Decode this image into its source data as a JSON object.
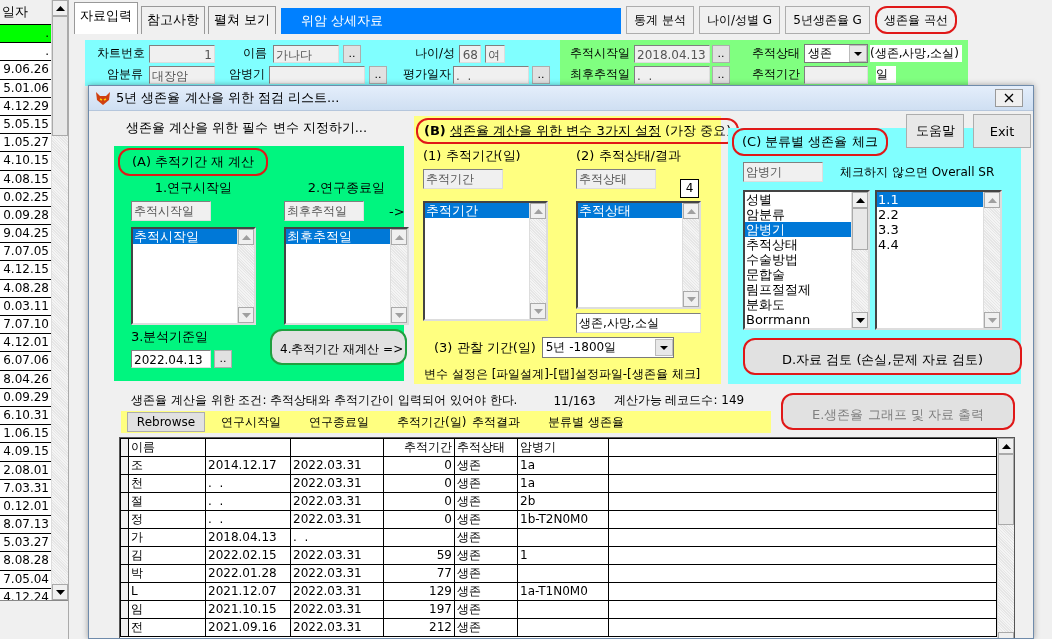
{
  "app": {
    "record_list": {
      "header": "일자",
      "rows": [
        {
          "value": ".",
          "selected": true
        },
        {
          "value": ".",
          "selected": false
        },
        {
          "value": "9.06.26",
          "selected": false
        },
        {
          "value": "5.01.06",
          "selected": false
        },
        {
          "value": "4.12.29",
          "selected": false
        },
        {
          "value": "5.05.15",
          "selected": false
        },
        {
          "value": "1.05.27",
          "selected": false
        },
        {
          "value": "4.10.15",
          "selected": false
        },
        {
          "value": "4.08.15",
          "selected": false
        },
        {
          "value": "0.02.25",
          "selected": false
        },
        {
          "value": "0.09.28",
          "selected": false
        },
        {
          "value": "9.04.25",
          "selected": false
        },
        {
          "value": "7.07.05",
          "selected": false
        },
        {
          "value": "4.12.15",
          "selected": false
        },
        {
          "value": "4.08.28",
          "selected": false
        },
        {
          "value": "0.03.11",
          "selected": false
        },
        {
          "value": "7.07.10",
          "selected": false
        },
        {
          "value": "4.12.01",
          "selected": false
        },
        {
          "value": "6.07.06",
          "selected": false
        },
        {
          "value": "8.04.26",
          "selected": false
        },
        {
          "value": "0.09.29",
          "selected": false
        },
        {
          "value": "6.10.31",
          "selected": false
        },
        {
          "value": "1.06.15",
          "selected": false
        },
        {
          "value": "4.09.15",
          "selected": false
        },
        {
          "value": "2.08.01",
          "selected": false
        },
        {
          "value": "7.03.31",
          "selected": false
        },
        {
          "value": "0.12.01",
          "selected": false
        },
        {
          "value": "8.07.13",
          "selected": false
        },
        {
          "value": "5.03.27",
          "selected": false
        },
        {
          "value": "8.08.28",
          "selected": false
        },
        {
          "value": "7.05.04",
          "selected": false
        },
        {
          "value": "4.12.24",
          "selected": false
        }
      ]
    },
    "tabs": [
      {
        "label": "자료입력",
        "selected": true
      },
      {
        "label": "참고사항",
        "selected": false
      },
      {
        "label": "펼쳐 보기",
        "selected": false
      }
    ],
    "banner": "위암 상세자료",
    "toolbar": [
      {
        "label": "통계 분석",
        "circled": false
      },
      {
        "label": "나이/성별 G",
        "circled": false
      },
      {
        "label": "5년생존율 G",
        "circled": false
      },
      {
        "label": "생존율 곡선",
        "circled": true,
        "color": "#e01818"
      }
    ],
    "patient_panel": {
      "rows": [
        [
          {
            "kind": "label",
            "text": "차트번호"
          },
          {
            "kind": "number_field",
            "value": "1"
          },
          {
            "kind": "label",
            "text": "이름"
          },
          {
            "kind": "field",
            "value": "가나다"
          },
          {
            "kind": "button",
            "text": ".."
          },
          {
            "kind": "label",
            "text": "나이/성"
          },
          {
            "kind": "number_field",
            "value": "68"
          },
          {
            "kind": "field",
            "value": "여"
          }
        ],
        [
          {
            "kind": "label",
            "text": "암분류"
          },
          {
            "kind": "field",
            "value": "대장암"
          },
          {
            "kind": "label",
            "text": "암병기"
          },
          {
            "kind": "field"
          },
          {
            "kind": "button",
            "text": ".."
          },
          {
            "kind": "label",
            "text": "평가일자"
          },
          {
            "kind": "field",
            "value": ".  ."
          },
          {
            "kind": "button",
            "text": ".."
          }
        ]
      ]
    },
    "tracking_panel": {
      "rows": [
        [
          {
            "kind": "label",
            "text": "추적시작일"
          },
          {
            "kind": "field",
            "value": "2018.04.13"
          },
          {
            "kind": "button",
            "text": ".."
          },
          {
            "kind": "label",
            "text": "추적상태"
          },
          {
            "kind": "dropdown",
            "value": "생존"
          },
          {
            "kind": "note",
            "text": "(생존,사망,소실)"
          }
        ],
        [
          {
            "kind": "label",
            "text": "최후추적일"
          },
          {
            "kind": "field",
            "value": ".  ."
          },
          {
            "kind": "button",
            "text": ".."
          },
          {
            "kind": "label",
            "text": "추적기간"
          },
          {
            "kind": "field"
          },
          {
            "kind": "note",
            "text": "일"
          }
        ]
      ]
    }
  },
  "dialog": {
    "title": "5년 생존율 계산을 위한 점검 리스트...",
    "intro": "생존율 계산을 위한 필수 변수 지정하기...",
    "panel_a": {
      "heading": "(A) 추적기간 재 계산",
      "circled": true,
      "color": "#e01818",
      "columns": [
        {
          "label": "1.연구시작일",
          "field": "추적시작일",
          "items": [
            {
              "label": "추적시작일",
              "selected": true
            }
          ]
        },
        {
          "label": "2.연구종료일",
          "field": "최후추적일",
          "arrow": "->",
          "items": [
            {
              "label": "최후추적일",
              "selected": true
            }
          ]
        }
      ],
      "date_label": "3.분석기준일",
      "date_value": "2022.04.13",
      "date_button": "..",
      "recalc_button": {
        "label": "4.추적기간 재계산 =>",
        "circled": true,
        "color": "#20a040"
      }
    },
    "panel_b": {
      "prefix": "(B)",
      "heading": "생존율 계산을 위한 변수 3가지 설정",
      "suffix": "(가장 중요)",
      "circled": true,
      "color": "#e01818",
      "columns": [
        {
          "label": "(1) 추적기간(일)",
          "field": "추적기간",
          "items": [
            {
              "label": "추적기간",
              "selected": true
            }
          ]
        },
        {
          "label": "(2) 추적상태/결과",
          "field": "추적상태",
          "badge": "4",
          "items": [
            {
              "label": "추적상태",
              "selected": true
            }
          ],
          "values": "생존,사망,소실"
        }
      ],
      "period_label": "(3) 관찰 기간(일)",
      "period_value": "5년 -1800일",
      "footer": "변수 설정은 [파일설계]-[탭]설정파일-[생존율 체크]"
    },
    "buttons": [
      "도움말",
      "Exit"
    ],
    "panel_c": {
      "heading": "(C) 분류별 생존율 체크",
      "circled": true,
      "color": "#e01818",
      "field": "암병기",
      "hint": "체크하지 않으면 Overall SR",
      "variables": [
        {
          "label": "성별",
          "selected": false
        },
        {
          "label": "암분류",
          "selected": false
        },
        {
          "label": "암병기",
          "selected": true
        },
        {
          "label": "추적상태",
          "selected": false
        },
        {
          "label": "수술방법",
          "selected": false
        },
        {
          "label": "문합술",
          "selected": false
        },
        {
          "label": "림프절절제",
          "selected": false
        },
        {
          "label": "분화도",
          "selected": false
        },
        {
          "label": "Borrmann",
          "selected": false
        }
      ],
      "values": [
        {
          "label": "1.1",
          "selected": true
        },
        {
          "label": "2.2",
          "selected": false
        },
        {
          "label": "3.3",
          "selected": false
        },
        {
          "label": "4.4",
          "selected": false
        }
      ],
      "review_button": {
        "label": "D.자료 검토 (손실,문제 자료 검토)",
        "circled": true,
        "color": "#e01818"
      }
    },
    "condition": "생존율 계산을 위한 조건: 추적상태와 추적기간이 입력되어 있어야 한다.",
    "count": "11/163",
    "calculable": "계산가능 레코드수: 149",
    "output_button": {
      "label": "E.생존율 그래프 및 자료 출력",
      "circled": true,
      "color": "#e01818",
      "disabled": true
    },
    "rebrowse": "Rebrowse",
    "bar_labels": [
      "연구시작일",
      "연구종료일",
      "추적기간(일)",
      "추적결과",
      "분류별 생존율"
    ],
    "table": {
      "header": {
        "name": "이름",
        "days": "추적기간",
        "status": "추적상태",
        "stage": "암병기"
      },
      "rows": [
        {
          "name": "조",
          "start": "2014.12.17",
          "end": "2022.03.31",
          "days": "0",
          "status": "생존",
          "stage": "1a"
        },
        {
          "name": "천",
          "start": ".  .",
          "end": "2022.03.31",
          "days": "0",
          "status": "생존",
          "stage": "1a"
        },
        {
          "name": "절",
          "start": ".  .",
          "end": "2022.03.31",
          "days": "0",
          "status": "생존",
          "stage": "2b"
        },
        {
          "name": "정",
          "start": ".  .",
          "end": "2022.03.31",
          "days": "0",
          "status": "생존",
          "stage": "1b-T2N0M0"
        },
        {
          "name": "가",
          "start": "2018.04.13",
          "end": ".  .",
          "status": "생존"
        },
        {
          "name": "김",
          "start": "2022.02.15",
          "end": "2022.03.31",
          "days": "59",
          "status": "생존",
          "stage": "1"
        },
        {
          "name": "박",
          "start": "2022.01.28",
          "end": "2022.03.31",
          "days": "77",
          "status": "생존"
        },
        {
          "name": "L",
          "start": "2021.12.07",
          "end": "2022.03.31",
          "days": "129",
          "status": "생존",
          "stage": "1a-T1N0M0"
        },
        {
          "name": "임",
          "start": "2021.10.15",
          "end": "2022.03.31",
          "days": "197",
          "status": "생존"
        },
        {
          "name": "전",
          "start": "2021.09.16",
          "end": "2022.03.31",
          "days": "212",
          "status": "생존"
        }
      ]
    }
  }
}
